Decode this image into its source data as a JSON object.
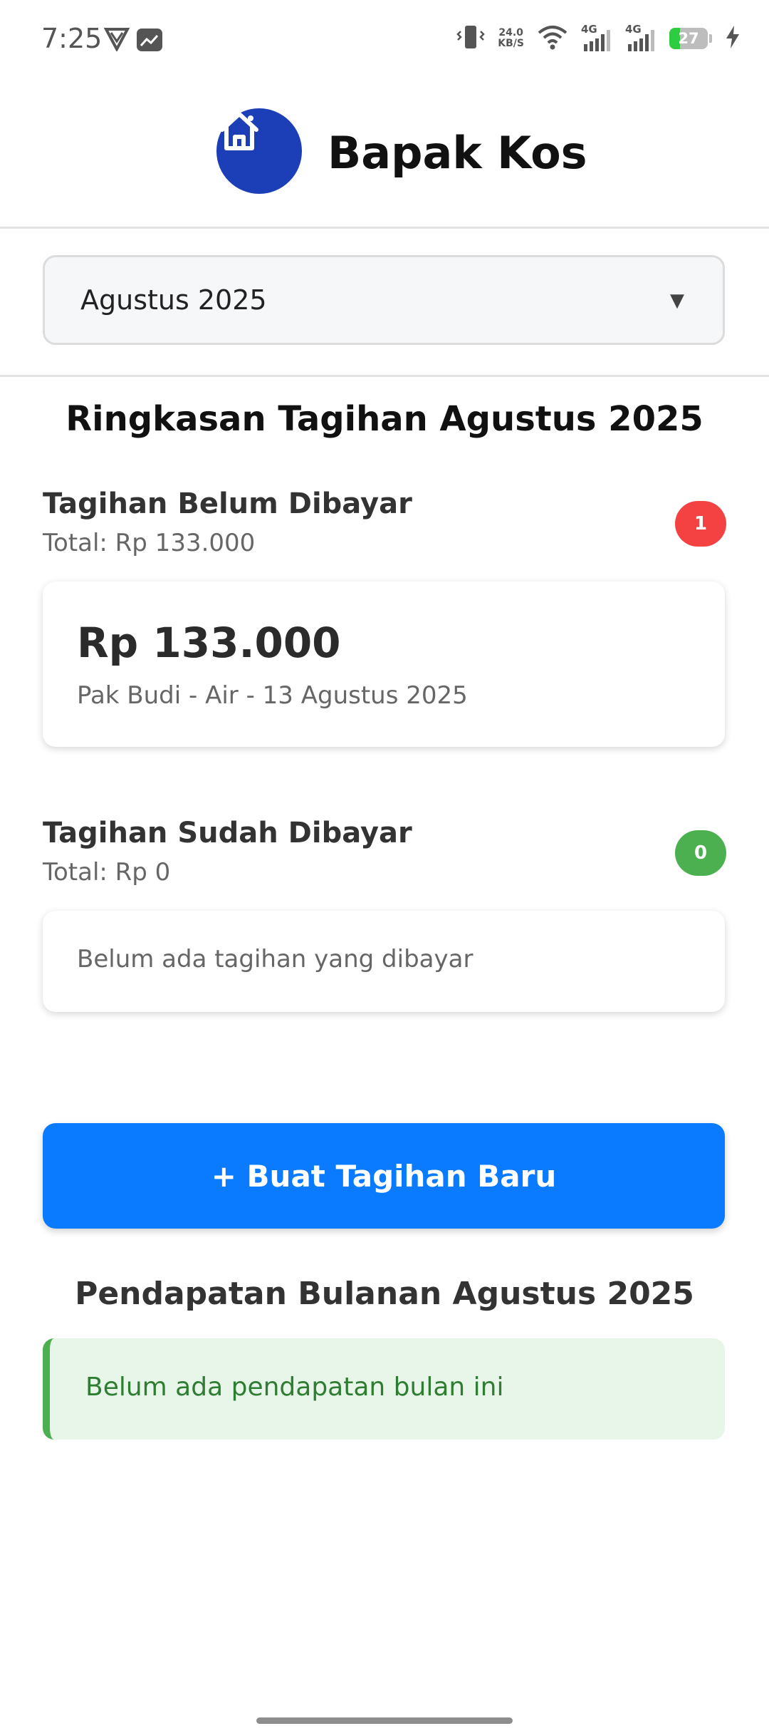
{
  "status_bar": {
    "time": "7:25",
    "net_speed_value": "24.0",
    "net_speed_unit": "KB/S",
    "signal1_label": "4G",
    "signal2_label": "4G",
    "battery_level": "27",
    "battery_fraction": 0.27
  },
  "header": {
    "title": "Bapak Kos",
    "logo_icon": "home-icon",
    "logo_color": "#1c3fb8"
  },
  "month_select": {
    "value": "Agustus 2025",
    "caret": "▼"
  },
  "summary": {
    "title": "Ringkasan Tagihan Agustus 2025",
    "unpaid": {
      "title": "Tagihan Belum Dibayar",
      "total": "Total: Rp 133.000",
      "count": "1",
      "badge_color": "#f44242",
      "bills": [
        {
          "amount": "Rp 133.000",
          "description": "Pak Budi - Air - 13 Agustus 2025"
        }
      ]
    },
    "paid": {
      "title": "Tagihan Sudah Dibayar",
      "total": "Total: Rp 0",
      "count": "0",
      "badge_color": "#4caf50",
      "empty_message": "Belum ada tagihan yang dibayar"
    }
  },
  "actions": {
    "new_bill_label": "+ Buat Tagihan Baru",
    "accent": "#0a7bff"
  },
  "income": {
    "title": "Pendapatan Bulanan Agustus 2025",
    "message": "Belum ada pendapatan bulan ini"
  }
}
